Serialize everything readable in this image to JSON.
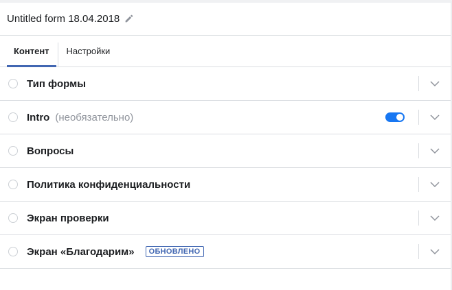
{
  "header": {
    "title": "Untitled form 18.04.2018",
    "edit_icon": "pencil-icon"
  },
  "tabs": [
    {
      "label": "Контент",
      "active": true
    },
    {
      "label": "Настройки",
      "active": false
    }
  ],
  "sections": [
    {
      "title": "Тип формы"
    },
    {
      "title": "Intro",
      "optional": "(необязательно)",
      "toggle_on": true
    },
    {
      "title": "Вопросы"
    },
    {
      "title": "Политика конфиденциальности"
    },
    {
      "title": "Экран проверки"
    },
    {
      "title": "Экран «Благодарим»",
      "badge": "ОБНОВЛЕНО"
    }
  ],
  "colors": {
    "accent": "#4267b2",
    "toggle": "#1877f2",
    "border": "#dadde1",
    "muted_text": "#90949c"
  }
}
